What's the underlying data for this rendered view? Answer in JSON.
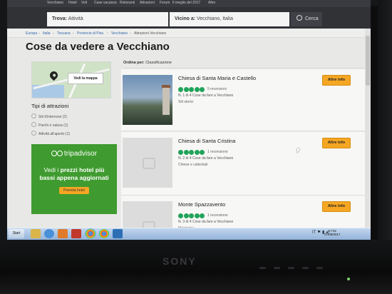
{
  "monitor": {
    "brand": "SONY"
  },
  "topnav": {
    "items": [
      "Vecchiano",
      "Hotel",
      "Voli",
      "Case vacanza",
      "Ristoranti",
      "Attrazioni",
      "Forum",
      "Il meglio del 2017",
      "Altro"
    ]
  },
  "search": {
    "what_label": "Trova:",
    "what_value": "Attività",
    "where_label": "Vicino a:",
    "where_value": "Vecchiano, Italia",
    "button_label": "Cerca"
  },
  "breadcrumb": [
    "Europa",
    "Italia",
    "Toscana",
    "Provincia di Pisa",
    "Vecchiano",
    "Attrazioni Vecchiano"
  ],
  "page_title": "Cose da vedere a Vecchiano",
  "map": {
    "button_label": "Vedi la mappa"
  },
  "filters": {
    "title": "Tipi di attrazioni",
    "items": [
      "Siti d'interesse (2)",
      "Parchi e natura (1)",
      "Attività all'aperto (1)"
    ]
  },
  "ad": {
    "brand": "tripadvisor",
    "headline_pre": "Vedi i ",
    "headline_bold": "prezzi hotel più bassi appena aggiornati",
    "cta": "Prenota hotel"
  },
  "results": {
    "sort_label": "Ordina per:",
    "sort_value": "Classificazione",
    "items": [
      {
        "name": "Chiesa di Santa Maria e Castello",
        "rating": 5,
        "reviews": "5 recensioni",
        "rank": "N. 1 di 4 Cose da fare a Vecchiano",
        "category": "Siti storici",
        "button": "Altre info"
      },
      {
        "name": "Chiesa di Santa Cristina",
        "rating": 5,
        "reviews": "1 recensione",
        "rank": "N. 2 di 4 Cose da fare a Vecchiano",
        "category": "Chiese e cattedrali",
        "button": "Altre info"
      },
      {
        "name": "Monte Spazzavento",
        "rating": 5,
        "reviews": "1 recensione",
        "rank": "N. 3 di 4 Cose da fare a Vecchiano",
        "category": "Montagne",
        "button": "Altre info"
      }
    ]
  },
  "taskbar": {
    "start_label": "Start",
    "lang": "IT",
    "time": "17:02",
    "date": "07/08/2017"
  },
  "colors": {
    "accent": "#f5a623",
    "rating_green": "#20a35a",
    "ad_green": "#3f9b2f"
  }
}
